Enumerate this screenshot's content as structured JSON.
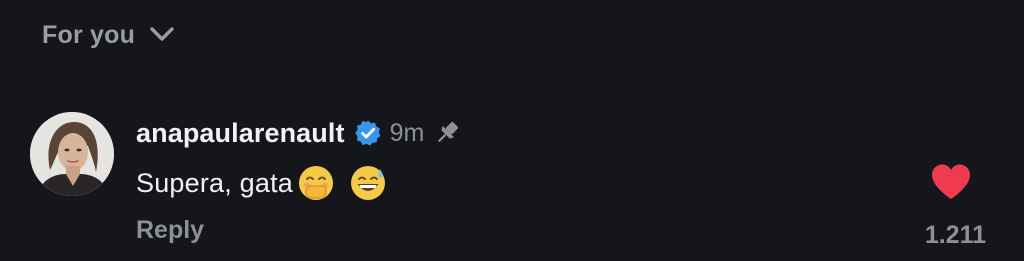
{
  "header": {
    "filter_label": "For you",
    "filter_icon": "chevron-down-icon"
  },
  "comment": {
    "username": "anapaularenault",
    "verified_icon": "verified-badge-icon",
    "timestamp": "9m",
    "pin_icon": "pin-icon",
    "text": "Supera, gata",
    "emojis": [
      "face-with-hand-over-mouth-emoji",
      "grinning-face-with-sweat-emoji"
    ],
    "reply_label": "Reply",
    "like_icon": "heart-icon",
    "like_count": "1.211"
  },
  "colors": {
    "background": "#15161b",
    "primary_text": "#f2f2f4",
    "secondary_text": "#8d9098",
    "verified_blue": "#3797f0",
    "like_red": "#ef3b4f",
    "emoji_yellow": "#f7c948"
  }
}
